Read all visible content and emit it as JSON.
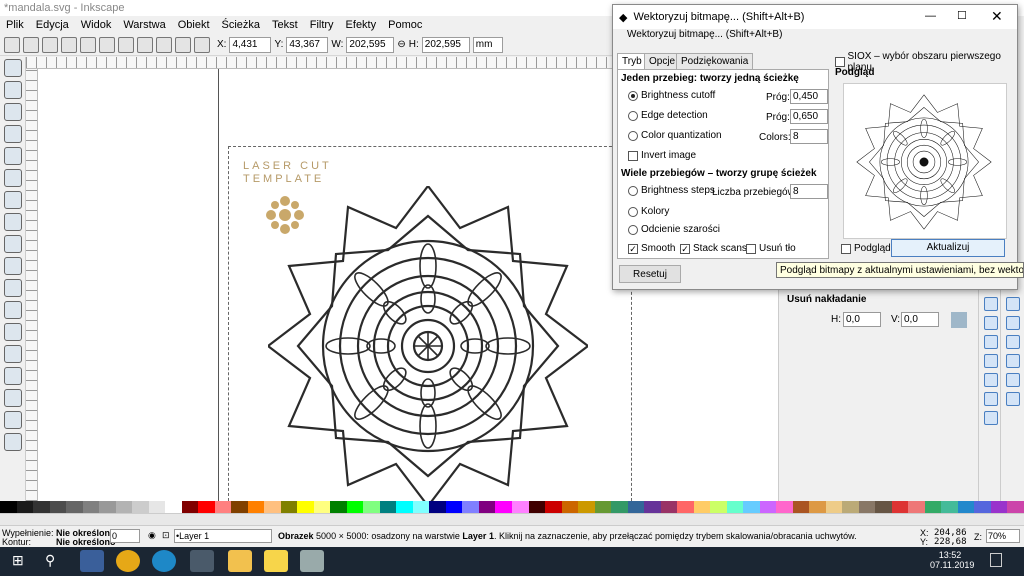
{
  "window": {
    "title": "*mandala.svg - Inkscape"
  },
  "menu": [
    "Plik",
    "Edycja",
    "Widok",
    "Warstwa",
    "Obiekt",
    "Ścieżka",
    "Tekst",
    "Filtry",
    "Efekty",
    "Pomoc"
  ],
  "toolbar": {
    "x_label": "X:",
    "x": "4,431",
    "y_label": "Y:",
    "y": "43,367",
    "w_label": "W:",
    "w": "202,595",
    "h_label": "H:",
    "h": "202,595",
    "unit": "mm"
  },
  "canvas": {
    "laser_line1": "LASER CUT",
    "laser_line2": "TEMPLATE"
  },
  "dialog": {
    "title": "Wektoryzuj bitmapę... (Shift+Alt+B)",
    "subtitle": "Wektoryzuj bitmapę... (Shift+Alt+B)",
    "tabs": [
      "Tryb",
      "Opcje",
      "Podziękowania"
    ],
    "single_header": "Jeden przebieg: tworzy jedną ścieżkę",
    "brightness_cutoff": "Brightness cutoff",
    "edge_detection": "Edge detection",
    "color_quantization": "Color quantization",
    "invert_image": "Invert image",
    "prog_label": "Próg:",
    "prog1": "0,450",
    "prog2": "0,650",
    "colors_label": "Colors:",
    "colors": "8",
    "multi_header": "Wiele przebiegów – tworzy grupę ścieżek",
    "brightness_steps": "Brightness steps",
    "scans_label": "Liczba przebiegów:",
    "scans": "8",
    "kolory": "Kolory",
    "odcienie": "Odcienie szarości",
    "smooth": "Smooth",
    "stack_scans": "Stack scans",
    "remove_bg": "Usuń tło",
    "siox": "SIOX – wybór obszaru pierwszego planu",
    "preview_label": "Podgląd",
    "preview_check": "Podgląd",
    "update_button": "Aktualizuj",
    "reset_button": "Resetuj"
  },
  "tooltip": "Podgląd bitmapy z aktualnymi ustawieniami, bez wektoryzacji",
  "right_panel": {
    "overlap_title": "Usuń nakładanie",
    "h_label": "H:",
    "h_val": "0,0",
    "v_label": "V:",
    "v_val": "0,0"
  },
  "status": {
    "fill_label": "Wypełnienie:",
    "fill_val": "Nie określono",
    "stroke_label": "Kontur:",
    "stroke_val": "Nie określono",
    "opacity": "0",
    "layer": "•Layer 1",
    "message_bold": "Obrazek",
    "message": "5000 × 5000: osadzony na warstwie",
    "message_layer": "Layer 1",
    "message_tail": ". Kliknij na zaznaczenie, aby przełączać pomiędzy trybem skalowania/obracania uchwytów.",
    "x_label": "X:",
    "x": "204,86",
    "y_label": "Y:",
    "y": "228,68",
    "z_label": "Z:",
    "zoom": "70%"
  },
  "taskbar": {
    "time": "13:52",
    "date": "07.11.2019"
  },
  "colors": {
    "laser": "#b69a68",
    "accent": "#4a7fc1",
    "taskbar": "#1b2633"
  }
}
